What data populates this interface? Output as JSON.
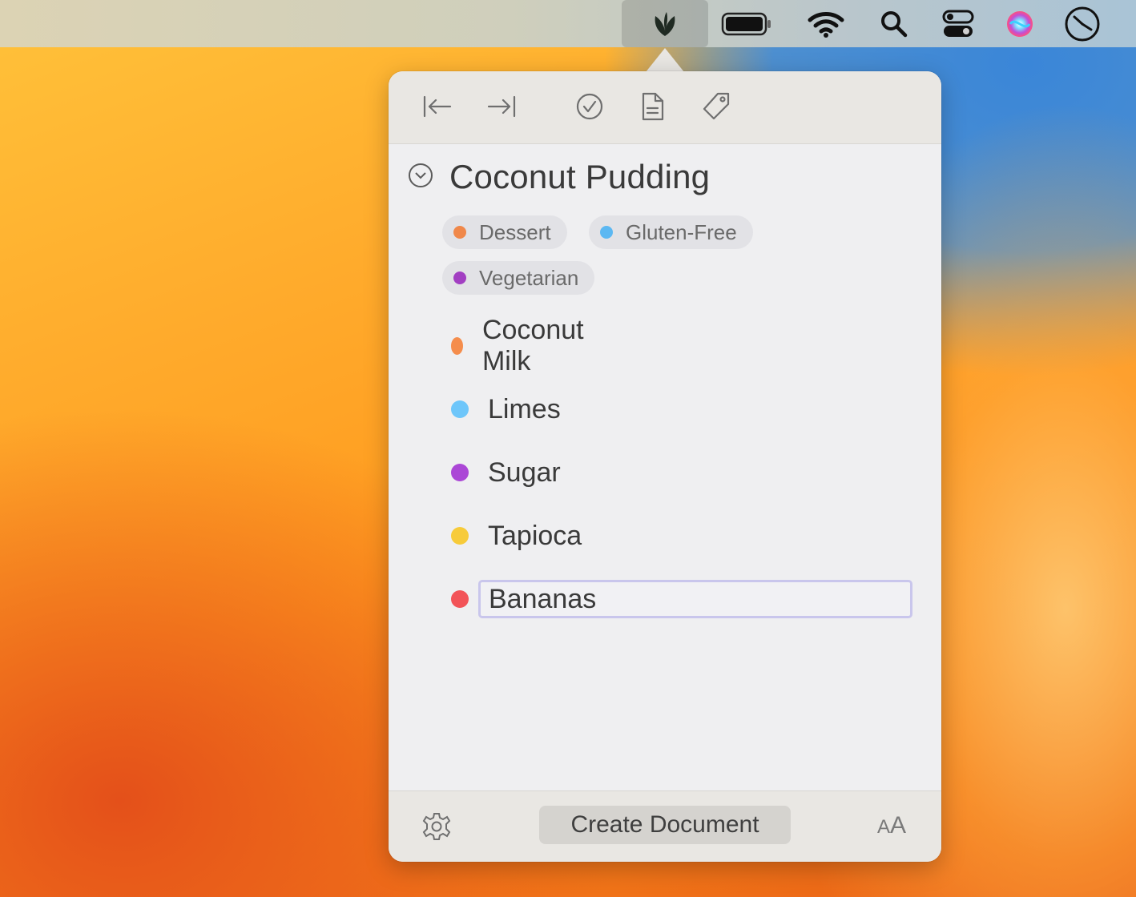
{
  "menubar": {
    "items": [
      "app-icon",
      "battery-icon",
      "wifi-icon",
      "search-icon",
      "control-center-icon",
      "siri-icon",
      "clock-icon"
    ]
  },
  "toolbar": {
    "buttons": [
      "outdent-icon",
      "indent-icon",
      "checkmark-circle-icon",
      "document-icon",
      "tag-icon"
    ]
  },
  "document": {
    "title": "Coconut Pudding",
    "tags": [
      {
        "label": "Dessert",
        "color": "#f0884a"
      },
      {
        "label": "Gluten-Free",
        "color": "#5cb8f2"
      },
      {
        "label": "Vegetarian",
        "color": "#a23fc2"
      }
    ],
    "items": [
      {
        "label": "Coconut Milk",
        "color": "#f58d4c"
      },
      {
        "label": "Limes",
        "color": "#6ec6fa"
      },
      {
        "label": "Sugar",
        "color": "#ab47d6"
      },
      {
        "label": "Tapioca",
        "color": "#f7cb3a"
      },
      {
        "label": "Bananas",
        "color": "#f25358"
      }
    ]
  },
  "footer": {
    "create_label": "Create Document",
    "font_small": "A",
    "font_big": "A"
  }
}
